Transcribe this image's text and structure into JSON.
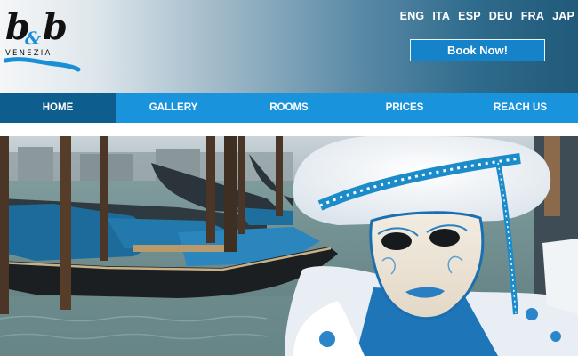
{
  "brand": {
    "logo_main": "b&b",
    "logo_sub": "VENEZIA"
  },
  "languages": [
    "ENG",
    "ITA",
    "ESP",
    "DEU",
    "FRA",
    "JAP"
  ],
  "book_button": "Book Now!",
  "nav": {
    "items": [
      "HOME",
      "GALLERY",
      "ROOMS",
      "PRICES",
      "REACH US"
    ],
    "active": "HOME"
  },
  "colors": {
    "nav_blue": "#1a93dd",
    "nav_active": "#0d5e8f",
    "button_blue": "#1583c9",
    "header_dark": "#215a7a"
  }
}
